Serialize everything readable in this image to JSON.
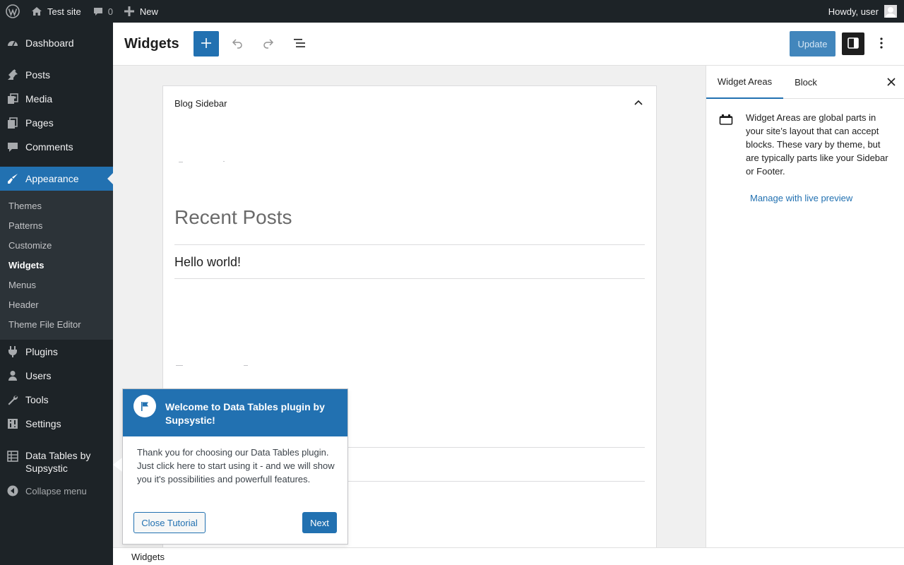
{
  "admin_bar": {
    "site_name": "Test site",
    "comments_count": "0",
    "new_label": "New",
    "greeting": "Howdy, user"
  },
  "sidebar": {
    "items": [
      {
        "label": "Dashboard",
        "icon": "dashboard-icon"
      },
      {
        "label": "Posts",
        "icon": "pushpin-icon"
      },
      {
        "label": "Media",
        "icon": "media-icon"
      },
      {
        "label": "Pages",
        "icon": "pages-icon"
      },
      {
        "label": "Comments",
        "icon": "comment-icon"
      },
      {
        "label": "Appearance",
        "icon": "paintbrush-icon"
      },
      {
        "label": "Plugins",
        "icon": "plugin-icon"
      },
      {
        "label": "Users",
        "icon": "users-icon"
      },
      {
        "label": "Tools",
        "icon": "wrench-icon"
      },
      {
        "label": "Settings",
        "icon": "settings-icon"
      },
      {
        "label": "Data Tables by Supsystic",
        "icon": "table-icon"
      }
    ],
    "appearance_submenu": [
      "Themes",
      "Patterns",
      "Customize",
      "Widgets",
      "Menus",
      "Header",
      "Theme File Editor"
    ],
    "collapse_label": "Collapse menu"
  },
  "header": {
    "title": "Widgets",
    "update_label": "Update"
  },
  "canvas": {
    "widget_area_title": "Blog Sidebar",
    "recent_posts_heading": "Recent Posts",
    "posts": [
      "Hello world!"
    ]
  },
  "settings_panel": {
    "tabs": [
      "Widget Areas",
      "Block"
    ],
    "description": "Widget Areas are global parts in your site’s layout that can accept blocks. These vary by theme, but are typically parts like your Sidebar or Footer.",
    "link_label": "Manage with live preview"
  },
  "footer": {
    "breadcrumb": "Widgets"
  },
  "tutorial": {
    "title": "Welcome to Data Tables plugin by Supsystic!",
    "body": "Thank you for choosing our Data Tables plugin. Just click here to start using it - and we will show you it's possibilities and powerfull features.",
    "close_label": "Close Tutorial",
    "next_label": "Next"
  },
  "colors": {
    "accent": "#2271b1",
    "admin_dark": "#1d2327",
    "submenu_bg": "#2c3338"
  }
}
